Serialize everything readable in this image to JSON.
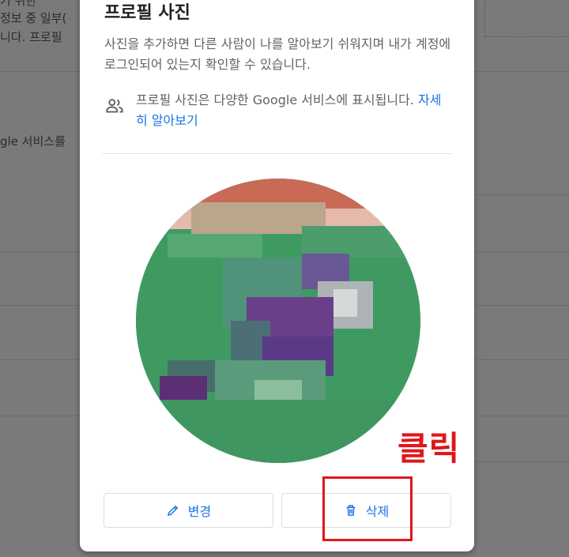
{
  "background": {
    "snippets": [
      "기 위한",
      "정보 중 일부(",
      "니다. 프로필 ",
      "gle 서비스를"
    ]
  },
  "dialog": {
    "title": "프로필 사진",
    "description": "사진을 추가하면 다른 사람이 나를 알아보기 쉬워지며 내가 계정에 로그인되어 있는지 확인할 수 있습니다.",
    "info_text": "프로필 사진은 다양한 Google 서비스에 표시됩니다.",
    "info_link": "자세히 알아보기",
    "info_icon": "people-icon",
    "change_label": "변경",
    "change_icon": "pencil-icon",
    "delete_label": "삭제",
    "delete_icon": "trash-icon"
  },
  "annotation": {
    "label": "클릭",
    "color": "#e0161a"
  },
  "colors": {
    "accent": "#1a73e8",
    "scrim": "#7a7a7a"
  }
}
